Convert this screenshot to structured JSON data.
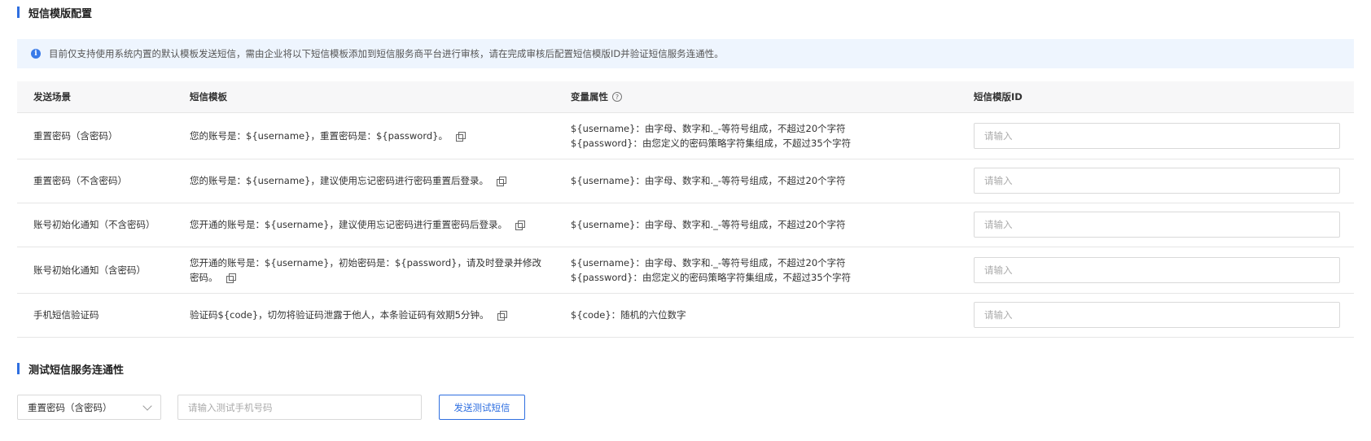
{
  "sections": {
    "template_title": "短信模版配置",
    "test_title": "测试短信服务连通性"
  },
  "notice": {
    "text": "目前仅支持使用系统内置的默认模板发送短信，需由企业将以下短信模板添加到短信服务商平台进行审核，请在完成审核后配置短信模版ID并验证短信服务连通性。"
  },
  "table": {
    "headers": {
      "scene": "发送场景",
      "template": "短信模板",
      "variables": "变量属性",
      "template_id": "短信模版ID"
    },
    "rows": [
      {
        "scene": "重置密码（含密码）",
        "template": "您的账号是：${username}，重置密码是：${password}。",
        "variables": [
          "${username}：由字母、数字和._-等符号组成，不超过20个字符",
          "${password}：由您定义的密码策略字符集组成，不超过35个字符"
        ],
        "id_placeholder": "请输入"
      },
      {
        "scene": "重置密码（不含密码）",
        "template": "您的账号是：${username}，建议使用忘记密码进行密码重置后登录。",
        "variables": [
          "${username}：由字母、数字和._-等符号组成，不超过20个字符"
        ],
        "id_placeholder": "请输入"
      },
      {
        "scene": "账号初始化通知（不含密码）",
        "template": "您开通的账号是：${username}，建议使用忘记密码进行重置密码后登录。",
        "variables": [
          "${username}：由字母、数字和._-等符号组成，不超过20个字符"
        ],
        "id_placeholder": "请输入"
      },
      {
        "scene": "账号初始化通知（含密码）",
        "template": "您开通的账号是：${username}，初始密码是：${password}，请及时登录并修改密码。",
        "variables": [
          "${username}：由字母、数字和._-等符号组成，不超过20个字符",
          "${password}：由您定义的密码策略字符集组成，不超过35个字符"
        ],
        "id_placeholder": "请输入"
      },
      {
        "scene": "手机短信验证码",
        "template": "验证码${code}，切勿将验证码泄露于他人，本条验证码有效期5分钟。",
        "variables": [
          "${code}：随机的六位数字"
        ],
        "id_placeholder": "请输入"
      }
    ]
  },
  "test": {
    "selected_scene": "重置密码（含密码）",
    "phone_placeholder": "请输入测试手机号码",
    "send_label": "发送测试短信"
  },
  "colors": {
    "accent": "#2f6fe0",
    "notice_bg": "#eef5fe",
    "header_bg": "#f7f7f8"
  }
}
